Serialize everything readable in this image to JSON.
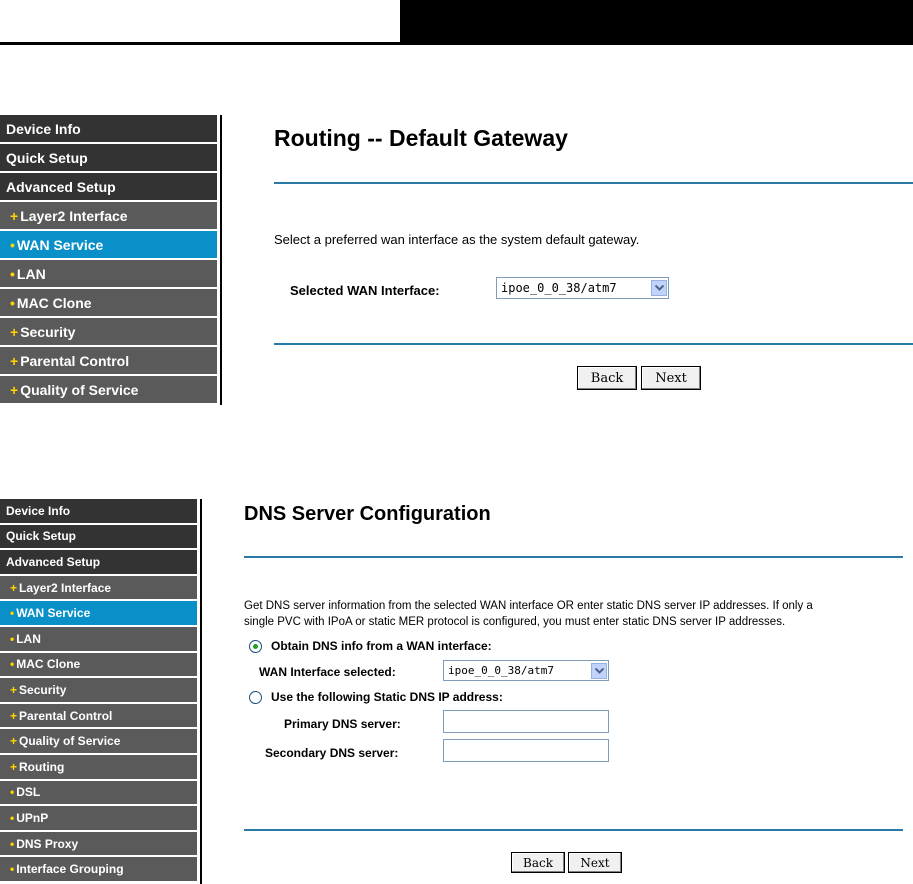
{
  "panel1": {
    "sidebar": [
      {
        "label": "Device Info",
        "type": "main"
      },
      {
        "label": "Quick Setup",
        "type": "main"
      },
      {
        "label": "Advanced Setup",
        "type": "main"
      },
      {
        "label": "Layer2 Interface",
        "type": "sub",
        "bullet": "+"
      },
      {
        "label": "WAN Service",
        "type": "sub",
        "bullet": "•",
        "active": true
      },
      {
        "label": "LAN",
        "type": "sub",
        "bullet": "•"
      },
      {
        "label": "MAC Clone",
        "type": "sub",
        "bullet": "•"
      },
      {
        "label": "Security",
        "type": "sub",
        "bullet": "+"
      },
      {
        "label": "Parental Control",
        "type": "sub",
        "bullet": "+"
      },
      {
        "label": "Quality of Service",
        "type": "sub",
        "bullet": "+"
      }
    ],
    "title": "Routing -- Default Gateway",
    "description": "Select a preferred wan interface as the system default gateway.",
    "wan_label": "Selected WAN Interface:",
    "wan_value": "ipoe_0_0_38/atm7",
    "back": "Back",
    "next": "Next"
  },
  "panel2": {
    "sidebar": [
      {
        "label": "Device Info",
        "type": "main"
      },
      {
        "label": "Quick Setup",
        "type": "main"
      },
      {
        "label": "Advanced Setup",
        "type": "main"
      },
      {
        "label": "Layer2 Interface",
        "type": "sub",
        "bullet": "+"
      },
      {
        "label": "WAN Service",
        "type": "sub",
        "bullet": "•",
        "active": true
      },
      {
        "label": "LAN",
        "type": "sub",
        "bullet": "•"
      },
      {
        "label": "MAC Clone",
        "type": "sub",
        "bullet": "•"
      },
      {
        "label": "Security",
        "type": "sub",
        "bullet": "+"
      },
      {
        "label": "Parental Control",
        "type": "sub",
        "bullet": "+"
      },
      {
        "label": "Quality of Service",
        "type": "sub",
        "bullet": "+"
      },
      {
        "label": "Routing",
        "type": "sub",
        "bullet": "+"
      },
      {
        "label": "DSL",
        "type": "sub",
        "bullet": "•"
      },
      {
        "label": "UPnP",
        "type": "sub",
        "bullet": "•"
      },
      {
        "label": "DNS Proxy",
        "type": "sub",
        "bullet": "•"
      },
      {
        "label": "Interface Grouping",
        "type": "sub",
        "bullet": "•"
      }
    ],
    "title": "DNS Server Configuration",
    "description_line1": "Get DNS server information from the selected WAN interface OR enter static DNS server IP addresses. If only a",
    "description_line2": "single PVC with IPoA or static MER protocol is configured, you must enter static DNS server IP addresses.",
    "option_obtain": "Obtain DNS info from a WAN interface:",
    "wan_selected_label": "WAN Interface selected:",
    "wan_selected_value": "ipoe_0_0_38/atm7",
    "option_static": "Use the following Static DNS IP address:",
    "primary_label": "Primary DNS server:",
    "primary_value": "",
    "secondary_label": "Secondary DNS server:",
    "secondary_value": "",
    "back": "Back",
    "next": "Next"
  }
}
